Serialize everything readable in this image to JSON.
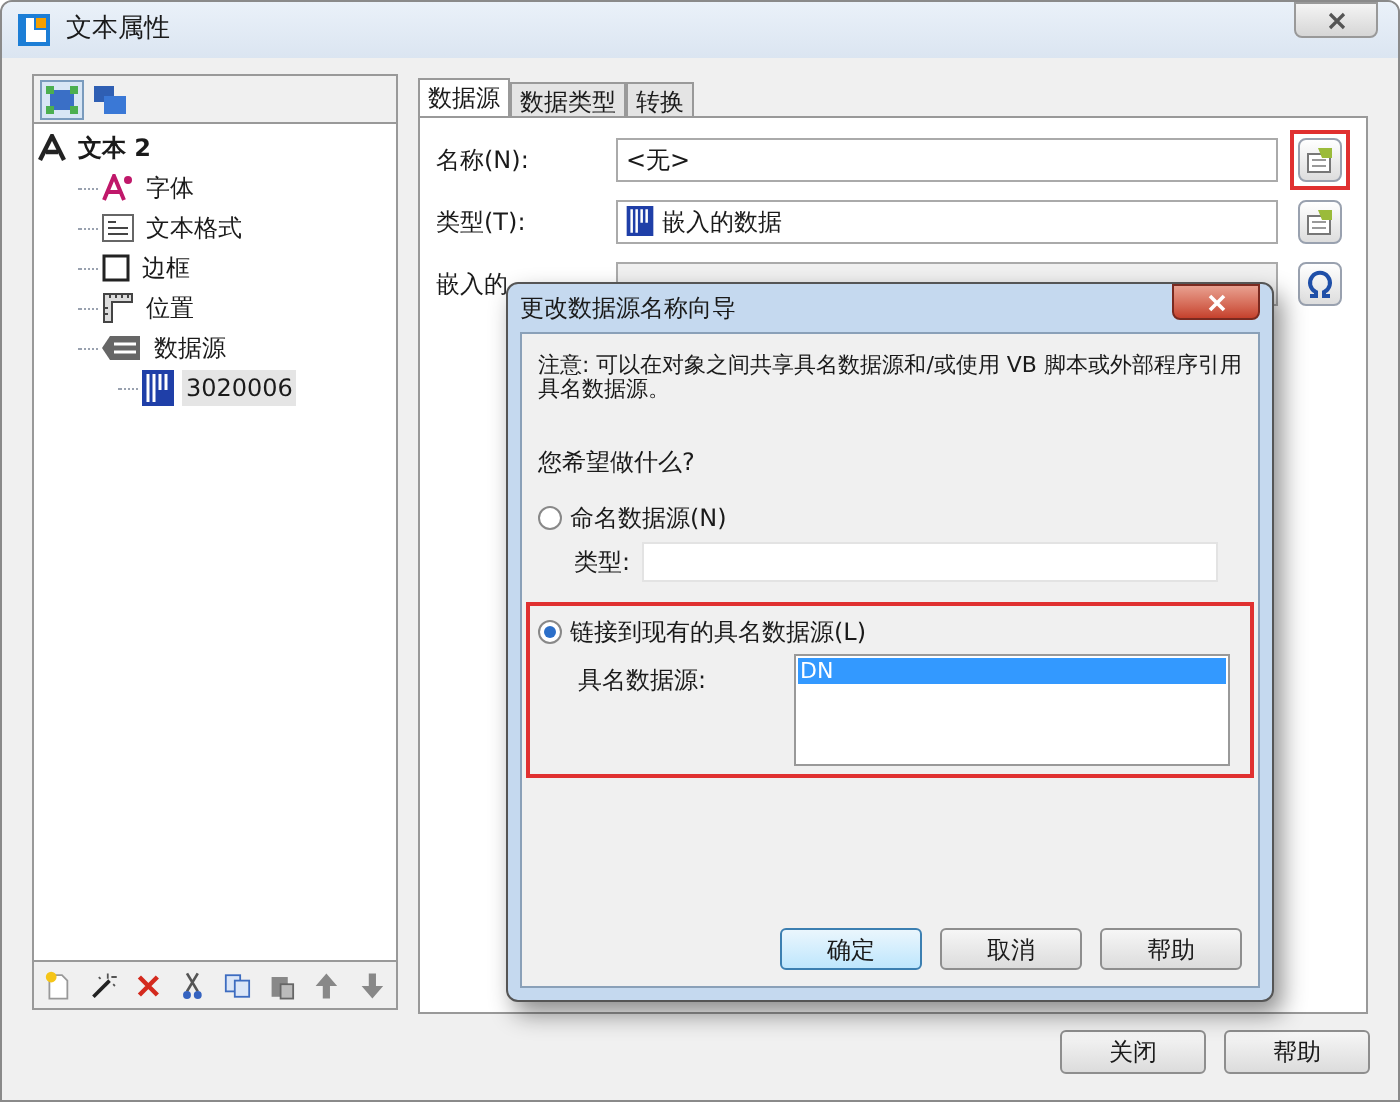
{
  "window": {
    "title": "文本属性"
  },
  "view_buttons": [
    {
      "kind": "layout",
      "selected": true
    },
    {
      "kind": "layers",
      "selected": false
    }
  ],
  "tree": [
    {
      "label": "文本 2",
      "kind": "text",
      "selected": false,
      "children": [
        {
          "label": "字体",
          "kind": "font",
          "selected": false
        },
        {
          "label": "文本格式",
          "kind": "format",
          "selected": false
        },
        {
          "label": "边框",
          "kind": "border",
          "selected": false
        },
        {
          "label": "位置",
          "kind": "position",
          "selected": false
        },
        {
          "label": "数据源",
          "kind": "datasource",
          "selected": false,
          "children": [
            {
              "label": "3020006",
              "kind": "barcode",
              "selected": true
            }
          ]
        }
      ]
    }
  ],
  "tabs": [
    {
      "label": "数据源",
      "selected": true
    },
    {
      "label": "数据类型",
      "selected": false
    },
    {
      "label": "转换",
      "selected": false
    }
  ],
  "fields": [
    {
      "label": "名称(N):",
      "value": "<无>",
      "kind": "name",
      "highlighted": true
    },
    {
      "label": "类型(T):",
      "value": "嵌入的数据",
      "kind": "type",
      "highlighted": false
    },
    {
      "label": "嵌入的",
      "kind": "data",
      "highlighted": false
    }
  ],
  "dialog": {
    "title": "更改数据源名称向导",
    "note": "注意: 可以在对象之间共享具名数据源和/或使用 VB 脚本或外部程序引用具名数据源。",
    "question": "您希望做什么?",
    "options": [
      {
        "label": "命名数据源(N)",
        "selected": false,
        "highlighted": false,
        "kind": "text",
        "field_label": "类型:"
      },
      {
        "label": "链接到现有的具名数据源(L)",
        "selected": true,
        "highlighted": true,
        "kind": "list",
        "field_label": "具名数据源:",
        "items": [
          {
            "label": "DN",
            "selected": true
          }
        ]
      }
    ],
    "buttons": [
      {
        "label": "确定",
        "default": true
      },
      {
        "label": "取消",
        "default": false
      },
      {
        "label": "帮助",
        "default": false
      }
    ]
  },
  "buttons": [
    "关闭",
    "帮助"
  ]
}
